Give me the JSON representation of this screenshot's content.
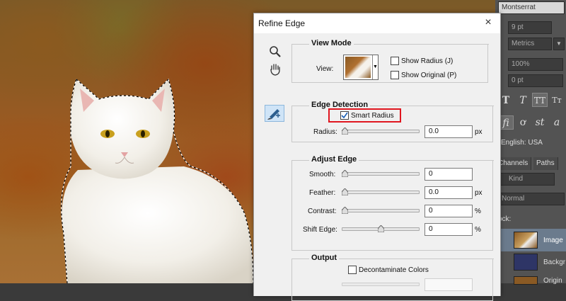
{
  "photoshop_panel": {
    "font_family": "Montserrat",
    "font_size": "9 pt",
    "kerning": "Metrics",
    "scale": "100%",
    "baseline": "0 pt",
    "language": "English: USA",
    "tabs": [
      "Channels",
      "Paths"
    ],
    "kind_filter": "Kind",
    "blend_mode": "Normal",
    "lock_label": "ock:",
    "layers": [
      "Image",
      "Backgr",
      "Origin"
    ]
  },
  "dialog": {
    "title": "Refine Edge",
    "close_symbol": "×",
    "view_mode": {
      "title": "View Mode",
      "view_label": "View:",
      "show_radius": {
        "label": "Show Radius (J)",
        "checked": false
      },
      "show_original": {
        "label": "Show Original (P)",
        "checked": false
      }
    },
    "edge_detection": {
      "title": "Edge Detection",
      "smart_radius": {
        "label": "Smart Radius",
        "checked": true
      },
      "radius": {
        "label": "Radius:",
        "value": "0.0",
        "unit": "px",
        "slider": 0
      }
    },
    "adjust_edge": {
      "title": "Adjust Edge",
      "smooth": {
        "label": "Smooth:",
        "value": "0",
        "unit": "",
        "slider": 0
      },
      "feather": {
        "label": "Feather:",
        "value": "0.0",
        "unit": "px",
        "slider": 0
      },
      "contrast": {
        "label": "Contrast:",
        "value": "0",
        "unit": "%",
        "slider": 0
      },
      "shift_edge": {
        "label": "Shift Edge:",
        "value": "0",
        "unit": "%",
        "slider": 0.5
      }
    },
    "output": {
      "title": "Output",
      "decontaminate": {
        "label": "Decontaminate Colors",
        "checked": false
      }
    }
  },
  "colors": {
    "highlight_box": "#e0161f",
    "selected_tool_bg": "#cfe4f7",
    "dialog_bg": "#f0f0f0"
  }
}
